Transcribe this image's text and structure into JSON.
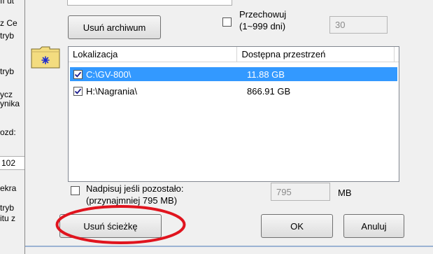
{
  "left_fragments": [
    "ıı ut",
    "z Ce",
    "tryb",
    "tryb",
    "ycz",
    "ynika",
    "ozd:",
    "102",
    "ekra",
    "tryb",
    "itu z"
  ],
  "archive": {
    "remove_button": "Usuń archiwum"
  },
  "retention": {
    "label_line1": "Przechowuj",
    "label_line2": "(1~999 dni)",
    "checked": false,
    "value": "30"
  },
  "locations": {
    "columns": [
      "Lokalizacja",
      "Dostępna przestrzeń"
    ],
    "rows": [
      {
        "path": "C:\\GV-800\\",
        "space": "11.88 GB",
        "checked": true,
        "selected": true
      },
      {
        "path": "H:\\Nagrania\\",
        "space": "866.91 GB",
        "checked": true,
        "selected": false
      }
    ]
  },
  "overwrite": {
    "label_line1": "Nadpisuj jeśli pozostało:",
    "label_line2": "(przynajmniej 795 MB)",
    "checked": false,
    "value": "795",
    "unit": "MB"
  },
  "buttons": {
    "remove_path": "Usuń ścieżkę",
    "ok": "OK",
    "cancel": "Anuluj"
  },
  "colors": {
    "selection": "#3399ff",
    "annotation": "#e0141e"
  }
}
